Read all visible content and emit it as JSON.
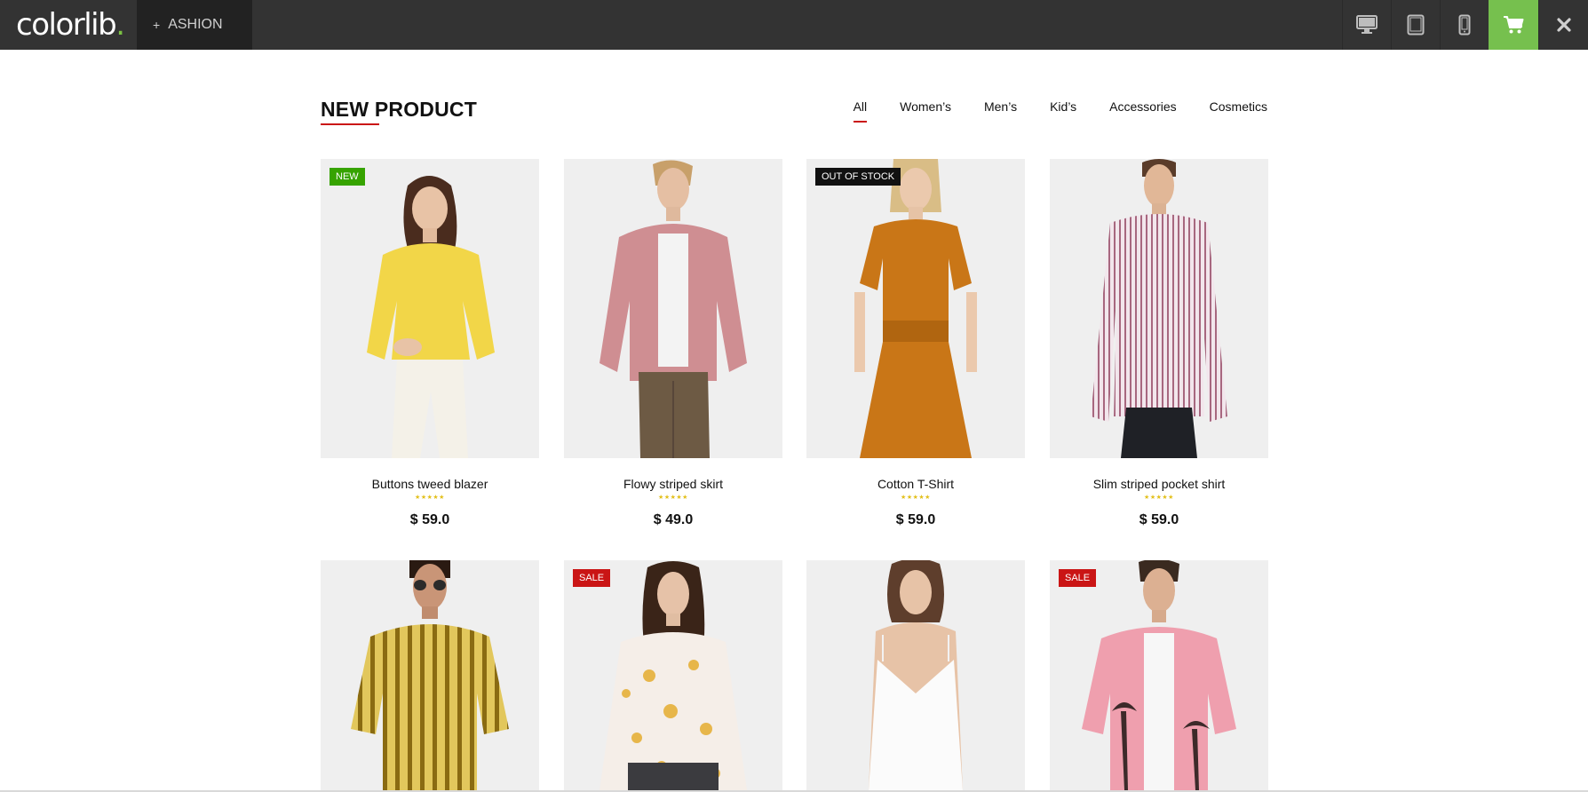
{
  "topbar": {
    "logo_text": "colorlib",
    "logo_dot": ".",
    "theme_plus": "+",
    "theme_label": "ASHION",
    "icons": [
      "desktop-icon",
      "tablet-icon",
      "mobile-icon",
      "cart-icon",
      "close-icon"
    ],
    "accent": "#76c04e"
  },
  "section": {
    "title": "NEW PRODUCT",
    "accent": "#ca1515",
    "filters": [
      "All",
      "Women’s",
      "Men’s",
      "Kid’s",
      "Accessories",
      "Cosmetics"
    ],
    "active_filter": "All"
  },
  "products": [
    {
      "name": "Buttons tweed blazer",
      "price": "$ 59.0",
      "rating": 5,
      "badge": "NEW"
    },
    {
      "name": "Flowy striped skirt",
      "price": "$ 49.0",
      "rating": 5,
      "badge": ""
    },
    {
      "name": "Cotton T-Shirt",
      "price": "$ 59.0",
      "rating": 5,
      "badge": "OUT OF STOCK"
    },
    {
      "name": "Slim striped pocket shirt",
      "price": "$ 59.0",
      "rating": 5,
      "badge": ""
    },
    {
      "name": "",
      "price": "",
      "rating": 0,
      "badge": ""
    },
    {
      "name": "",
      "price": "",
      "rating": 0,
      "badge": "SALE"
    },
    {
      "name": "",
      "price": "",
      "rating": 0,
      "badge": ""
    },
    {
      "name": "",
      "price": "",
      "rating": 0,
      "badge": "SALE"
    }
  ],
  "colors": {
    "badge_new": "#36a300",
    "badge_sale": "#ca1515",
    "badge_out": "#111111",
    "stars": "#e3c01c"
  }
}
